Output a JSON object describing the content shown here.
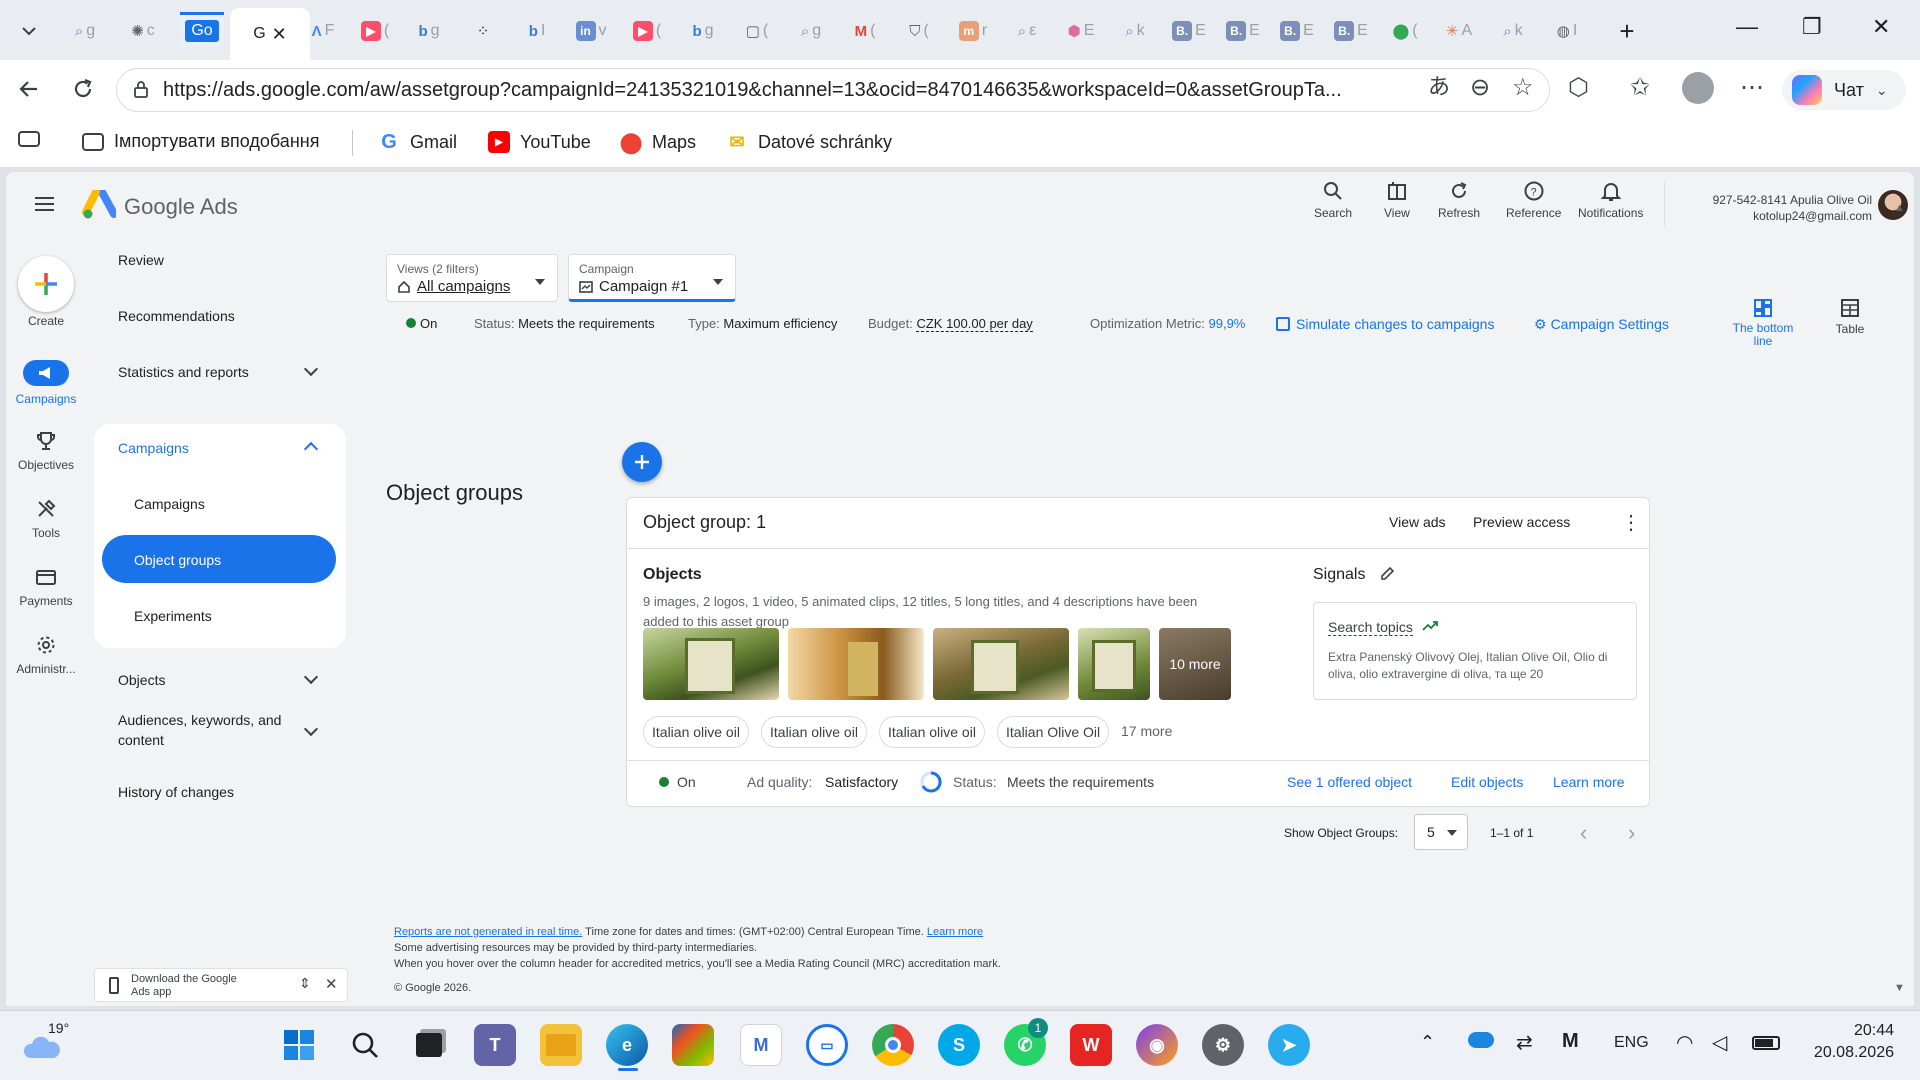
{
  "browser": {
    "url": "https://ads.google.com/aw/assetgroup?campaignId=24135321019&channel=13&ocid=8470146635&workspaceId=0&assetGroupTa...",
    "active_tab_label": "G",
    "go_tab_label": "Go",
    "copilot_label": "Чат",
    "bookmarks": [
      {
        "label": "Імпортувати вподобання",
        "icon": "import-icon"
      },
      {
        "label": "Gmail",
        "icon": "google-icon"
      },
      {
        "label": "YouTube",
        "icon": "youtube-icon"
      },
      {
        "label": "Maps",
        "icon": "maps-icon"
      },
      {
        "label": "Datové schránky",
        "icon": "mailbox-icon"
      }
    ]
  },
  "header": {
    "product": "Google Ads",
    "tools": [
      "Search",
      "View",
      "Refresh",
      "Reference",
      "Notifications"
    ],
    "account_line1": "927-542-8141 Apulia Olive Oil",
    "account_line2": "kotolup24@gmail.com"
  },
  "rail": {
    "create": "Create",
    "items": [
      "Campaigns",
      "Objectives",
      "Tools",
      "Payments",
      "Administr..."
    ]
  },
  "nav": {
    "review": "Review",
    "recommendations": "Recommendations",
    "statistics": "Statistics and reports",
    "campaigns_section": "Campaigns",
    "campaigns": "Campaigns",
    "object_groups": "Object groups",
    "experiments": "Experiments",
    "objects": "Objects",
    "audiences_line1": "Audiences, keywords, and",
    "audiences_line2": "content",
    "history": "History of changes",
    "download_line1": "Download the Google",
    "download_line2": "Ads app"
  },
  "filters": {
    "views_label": "Views (2 filters)",
    "views_value": "All campaigns",
    "campaign_label": "Campaign",
    "campaign_value": "Campaign #1"
  },
  "status_bar": {
    "on": "On",
    "status_label": "Status:",
    "status_value": "Meets the requirements",
    "type_label": "Type:",
    "type_value": "Maximum efficiency",
    "budget_label": "Budget:",
    "budget_value": "CZK 100.00 per day",
    "optimization_label": "Optimization Metric:",
    "optimization_value": "99,9%",
    "simulate": "Simulate changes to campaigns",
    "settings": "Campaign Settings"
  },
  "page": {
    "title": "Object groups",
    "view_bottom_line1": "The bottom",
    "view_bottom_line2": "line",
    "view_table": "Table"
  },
  "card": {
    "title": "Object group: 1",
    "view_ads": "View ads",
    "preview_access": "Preview access",
    "objects_heading": "Objects",
    "objects_desc_line1": "9 images, 2 logos, 1 video, 5 animated clips, 12 titles, 5 long titles, and 4 descriptions have been",
    "objects_desc_line2": "added to this asset group",
    "more_thumbs": "10 more",
    "chips": [
      "Italian olive oil",
      "Italian olive oil",
      "Italian olive oil",
      "Italian Olive Oil"
    ],
    "chips_more": "17 more",
    "signals_heading": "Signals",
    "search_topics": "Search topics",
    "topics_line1": "Extra Panenský Olivový Olej, Italian Olive Oil, Olio di",
    "topics_line2": "oliva, olio extravergine di oliva, та ще 20",
    "footer_on": "On",
    "ad_quality_label": "Ad quality:",
    "ad_quality_value": "Satisfactory",
    "status_label": "Status:",
    "status_value": "Meets the requirements",
    "see_offered": "See 1 offered object",
    "edit_objects": "Edit objects",
    "learn_more": "Learn more"
  },
  "pagination": {
    "show_label": "Show Object Groups:",
    "page_size": "5",
    "range": "1–1 of 1"
  },
  "footer": {
    "reports_link": "Reports are not generated in real time.",
    "timezone": " Time zone for dates and times: (GMT+02:00) Central European Time. ",
    "learn_more": "Learn more",
    "line2": "Some advertising resources may be provided by third-party intermediaries.",
    "line3": "When you hover over the column header for accredited metrics, you'll see a Media Rating Council (MRC) accreditation mark.",
    "copyright": "© Google 2026."
  },
  "taskbar": {
    "temperature": "19°",
    "language": "ENG",
    "time": "20:44",
    "date": "20.08.2026",
    "whatsapp_badge": "1"
  },
  "colors": {
    "accent": "#1a73e8",
    "green": "#188038",
    "panel": "#f1f3f4"
  }
}
